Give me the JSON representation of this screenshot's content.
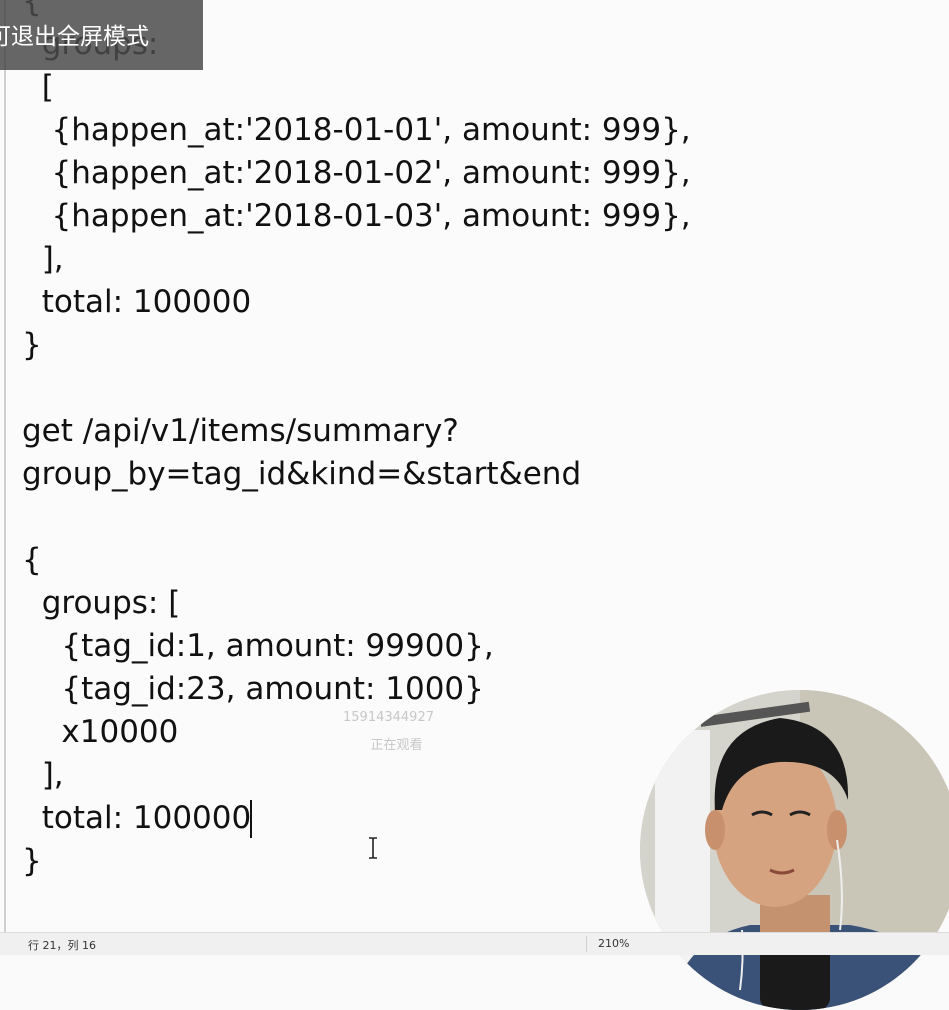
{
  "overlay": {
    "exit_fullscreen_text": "可退出全屏模式"
  },
  "editor": {
    "lines": [
      "{",
      "  groups:",
      "  [",
      "   {happen_at:'2018-01-01', amount: 999},",
      "   {happen_at:'2018-01-02', amount: 999},",
      "   {happen_at:'2018-01-03', amount: 999},",
      "  ],",
      "  total: 100000",
      "}",
      "",
      "get /api/v1/items/summary?",
      "group_by=tag_id&kind=&start&end",
      "",
      "{",
      "  groups: [",
      "    {tag_id:1, amount: 99900},",
      "    {tag_id:23, amount: 1000}",
      "    x10000",
      "  ],",
      "  total: 100000",
      "}"
    ]
  },
  "watermark": {
    "id": "15914344927",
    "status": "正在观看"
  },
  "statusbar": {
    "position": "行 21，列 16",
    "zoom": "210%"
  }
}
